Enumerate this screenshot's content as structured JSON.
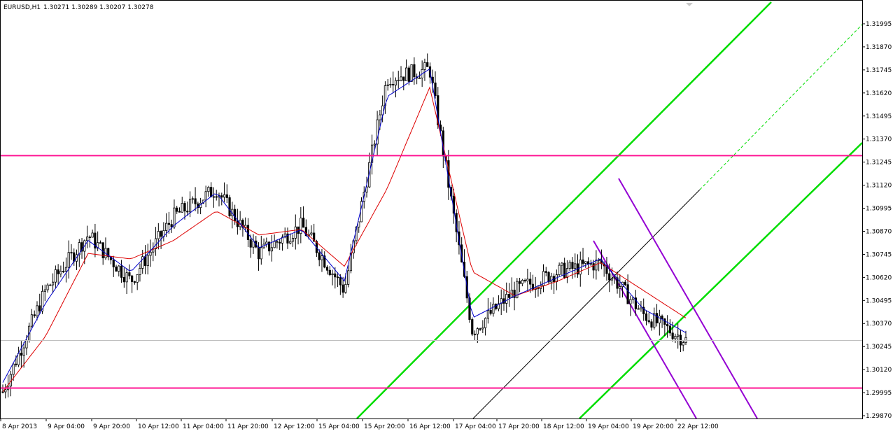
{
  "header": {
    "symbol": "EURUSD,H1",
    "ohlc": "1.30271 1.30289 1.30207 1.30278"
  },
  "price_axis": {
    "ticks": [
      "1.31995",
      "1.31870",
      "1.31745",
      "1.31620",
      "1.31495",
      "1.31370",
      "1.31245",
      "1.31120",
      "1.30995",
      "1.30870",
      "1.30745",
      "1.30620",
      "1.30495",
      "1.30370",
      "1.30245",
      "1.30120",
      "1.29995",
      "1.29870"
    ]
  },
  "time_axis": {
    "ticks": [
      "8 Apr 2013",
      "9 Apr 04:00",
      "9 Apr 20:00",
      "10 Apr 12:00",
      "11 Apr 04:00",
      "11 Apr 20:00",
      "12 Apr 12:00",
      "15 Apr 04:00",
      "15 Apr 20:00",
      "16 Apr 12:00",
      "17 Apr 04:00",
      "17 Apr 20:00",
      "18 Apr 12:00",
      "19 Apr 04:00",
      "19 Apr 20:00",
      "22 Apr 12:00"
    ]
  },
  "levels": [
    {
      "price": 1.3128,
      "label": "1.31280",
      "color": "#ff1493"
    },
    {
      "price": 1.3002,
      "label": "1.30020",
      "color": "#ff1493"
    }
  ],
  "current_price": {
    "price": 1.30278,
    "label": "1.30278",
    "color": "#000000"
  },
  "colors": {
    "candle": "#000000",
    "fast_ma": "#0000cc",
    "slow_ma": "#dd0000",
    "up_channel": "#00dd00",
    "down_channel": "#9400d3",
    "trendline": "#000000",
    "horizontal_level": "#ff1493"
  },
  "chart_data": {
    "type": "candlestick",
    "symbol": "EURUSD",
    "timeframe": "H1",
    "ylim": [
      1.2984,
      1.3209
    ],
    "x": [
      "8 Apr 2013",
      "9 Apr 04:00",
      "9 Apr 20:00",
      "10 Apr 12:00",
      "11 Apr 04:00",
      "11 Apr 20:00",
      "12 Apr 12:00",
      "15 Apr 04:00",
      "15 Apr 20:00",
      "16 Apr 12:00",
      "17 Apr 04:00",
      "17 Apr 20:00",
      "18 Apr 12:00",
      "19 Apr 04:00",
      "19 Apr 20:00",
      "22 Apr 12:00",
      "22 Apr 18:00"
    ],
    "close_series": {
      "name": "close",
      "values": [
        1.3,
        1.3055,
        1.3085,
        1.306,
        1.3095,
        1.311,
        1.3075,
        1.309,
        1.3055,
        1.317,
        1.3175,
        1.3033,
        1.3055,
        1.3065,
        1.307,
        1.3042,
        1.3028
      ]
    },
    "fast_ma": {
      "name": "MA fast",
      "values": [
        1.3005,
        1.3048,
        1.3082,
        1.3065,
        1.309,
        1.3108,
        1.3078,
        1.3088,
        1.306,
        1.316,
        1.3175,
        1.304,
        1.3052,
        1.3062,
        1.3072,
        1.3045,
        1.3032
      ]
    },
    "slow_ma": {
      "name": "MA slow",
      "values": [
        1.3,
        1.303,
        1.3075,
        1.3072,
        1.3082,
        1.3098,
        1.3085,
        1.3088,
        1.3068,
        1.311,
        1.3165,
        1.3065,
        1.3052,
        1.306,
        1.307,
        1.3055,
        1.304
      ]
    },
    "horizontal_levels": [
      1.3128,
      1.3002
    ],
    "current_price": 1.30278,
    "grid": false
  }
}
